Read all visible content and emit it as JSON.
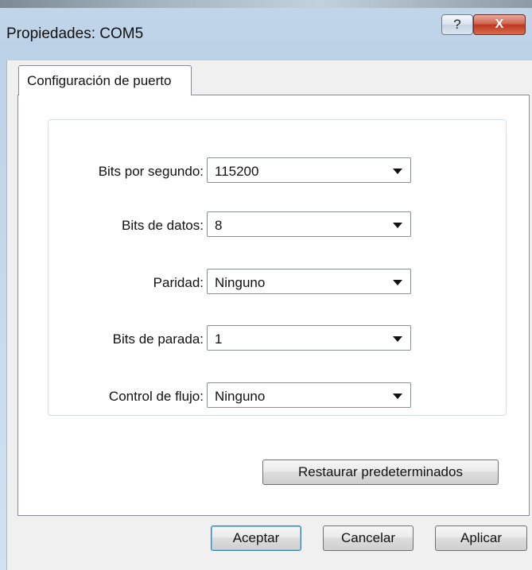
{
  "window": {
    "title": "Propiedades: COM5",
    "help_label": "?",
    "close_label": "X"
  },
  "tabs": [
    {
      "label": "Configuración de puerto",
      "selected": true
    }
  ],
  "fields": [
    {
      "label": "Bits por segundo:",
      "value": "115200"
    },
    {
      "label": "Bits de datos:",
      "value": "8"
    },
    {
      "label": "Paridad:",
      "value": "Ninguno"
    },
    {
      "label": "Bits de parada:",
      "value": "1"
    },
    {
      "label": "Control de flujo:",
      "value": "Ninguno"
    }
  ],
  "buttons": {
    "restore": "Restaurar predeterminados",
    "ok": "Aceptar",
    "cancel": "Cancelar",
    "apply": "Aplicar"
  },
  "icons": {
    "dropdown": "chevron-down-icon",
    "help": "help-icon",
    "close": "close-icon"
  }
}
